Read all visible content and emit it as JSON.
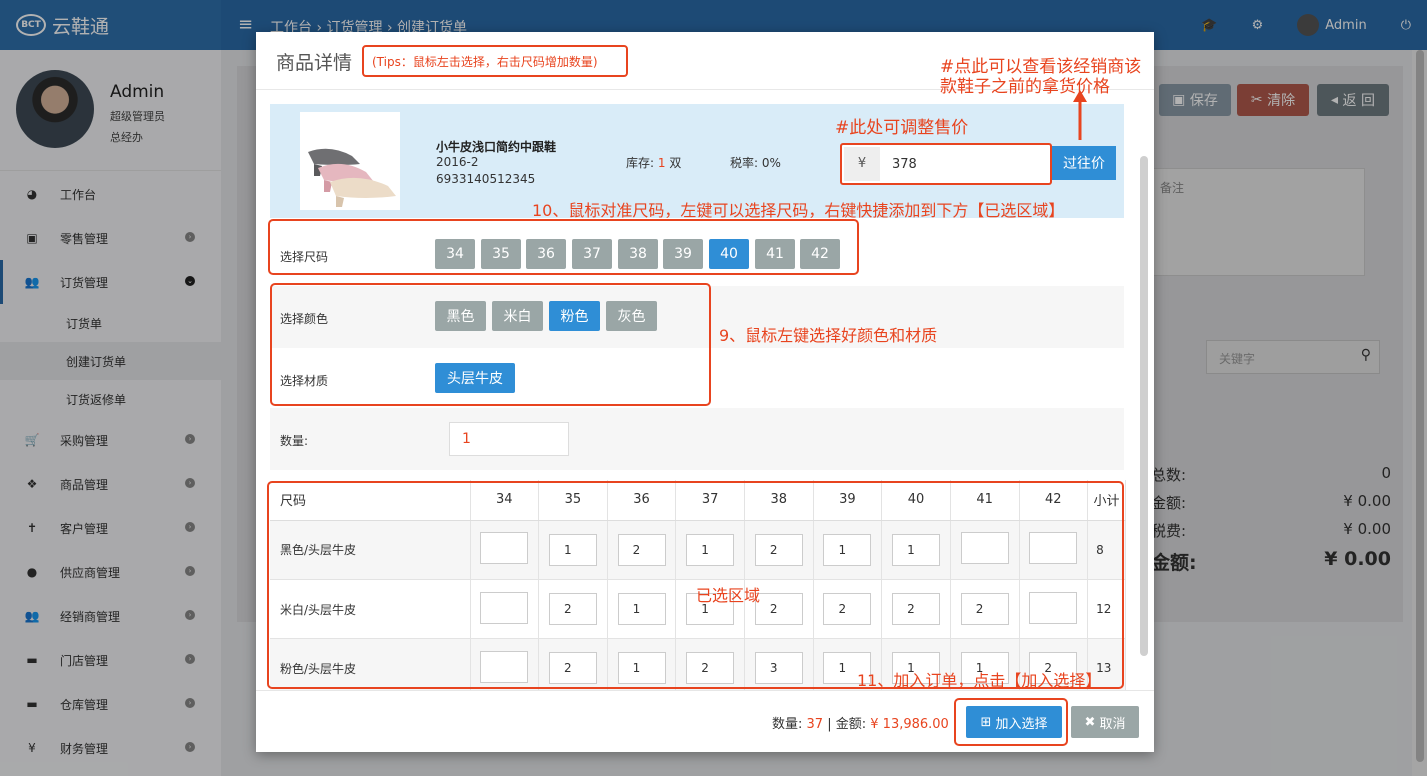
{
  "app": {
    "logo_mark": "BCT",
    "name": "云鞋通"
  },
  "header": {
    "breadcrumb": "工作台 › 订货管理 › 创建订货单",
    "user": "Admin"
  },
  "profile": {
    "name": "Admin",
    "role": "超级管理员",
    "dept": "总经办"
  },
  "sidebar": {
    "items": [
      {
        "label": "工作台",
        "icon": "dashboard-icon"
      },
      {
        "label": "零售管理",
        "icon": "cash-icon"
      },
      {
        "label": "订货管理",
        "icon": "users-icon"
      },
      {
        "label": "采购管理",
        "icon": "cart-icon"
      },
      {
        "label": "商品管理",
        "icon": "cubes-icon"
      },
      {
        "label": "客户管理",
        "icon": "person-icon"
      },
      {
        "label": "供应商管理",
        "icon": "user-icon"
      },
      {
        "label": "经销商管理",
        "icon": "group-icon"
      },
      {
        "label": "门店管理",
        "icon": "store-icon"
      },
      {
        "label": "仓库管理",
        "icon": "warehouse-icon"
      },
      {
        "label": "财务管理",
        "icon": "yen-icon"
      }
    ],
    "sub_items": [
      "订货单",
      "创建订货单",
      "订货返修单"
    ]
  },
  "background": {
    "save": "保存",
    "clear": "清除",
    "back": "返 回",
    "note_placeholder": "备注",
    "search_placeholder": "关键字",
    "stats": [
      {
        "label": "总数:",
        "value": "0"
      },
      {
        "label": "金额:",
        "value": "¥ 0.00"
      },
      {
        "label": "税费:",
        "value": "¥ 0.00"
      },
      {
        "label": "金额:",
        "value": "¥ 0.00"
      }
    ]
  },
  "modal": {
    "title": "商品详情",
    "tips": "(Tips：鼠标左击选择，右击尺码增加数量)",
    "product": {
      "name": "小牛皮浅口简约中跟鞋",
      "code": "2016-2",
      "barcode": "6933140512345",
      "stock_label": "库存:",
      "stock_value": "1",
      "stock_unit": "双",
      "tax": "税率: 0%",
      "currency": "¥",
      "price": "378",
      "history_button": "过往价"
    },
    "size_label": "选择尺码",
    "sizes": [
      "34",
      "35",
      "36",
      "37",
      "38",
      "39",
      "40",
      "41",
      "42"
    ],
    "selected_size": "40",
    "color_label": "选择颜色",
    "colors": [
      "黑色",
      "米白",
      "粉色",
      "灰色"
    ],
    "selected_color": "粉色",
    "material_label": "选择材质",
    "materials": [
      "头层牛皮"
    ],
    "qty_label": "数量:",
    "qty_value": "1",
    "table": {
      "headers": [
        "尺码",
        "34",
        "35",
        "36",
        "37",
        "38",
        "39",
        "40",
        "41",
        "42",
        "小计"
      ],
      "rows": [
        {
          "label": "黑色/头层牛皮",
          "cells": [
            "",
            "1",
            "2",
            "1",
            "2",
            "1",
            "1",
            "",
            ""
          ],
          "subtotal": "8"
        },
        {
          "label": "米白/头层牛皮",
          "cells": [
            "",
            "2",
            "1",
            "1",
            "2",
            "2",
            "2",
            "2",
            ""
          ],
          "subtotal": "12"
        },
        {
          "label": "粉色/头层牛皮",
          "cells": [
            "",
            "2",
            "1",
            "2",
            "3",
            "1",
            "1",
            "1",
            "2"
          ],
          "subtotal": "13"
        }
      ]
    },
    "footer": {
      "qty_label": "数量:",
      "qty_value": "37",
      "amount_label": "| 金额:",
      "amount_value": "¥ 13,986.00",
      "add_button": "加入选择",
      "cancel_button": "取消"
    }
  },
  "annotations": {
    "history_note_1": "#点此可以查看该经销商该",
    "history_note_2": "款鞋子之前的拿货价格",
    "price_note": "#此处可调整售价",
    "size_note": "10、鼠标对准尺码，左键可以选择尺码，右键快捷添加到下方【已选区域】",
    "color_note": "9、鼠标左键选择好颜色和材质",
    "selected_area": "已选区域",
    "add_note": "11、加入订单，点击【加入选择】"
  },
  "colors": {
    "accent": "#2f8ed6",
    "annotation": "#e8441f",
    "chip": "#9aa6a6",
    "topbar": "#2a6aa8"
  }
}
